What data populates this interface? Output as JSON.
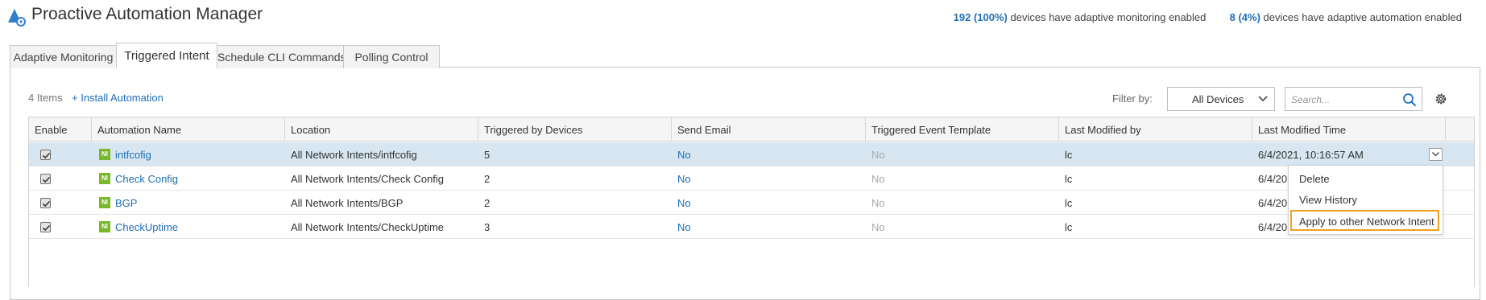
{
  "app": {
    "title": "Proactive Automation Manager",
    "logo_icon": "automation-logo-icon"
  },
  "stats": {
    "monitoring_count": "192 (100%)",
    "monitoring_text": "devices have adaptive monitoring enabled",
    "automation_count": "8 (4%)",
    "automation_text": "devices have adaptive automation enabled"
  },
  "tabs": [
    {
      "label": "Adaptive Monitoring",
      "active": false
    },
    {
      "label": "Triggered Intent",
      "active": true
    },
    {
      "label": "Schedule CLI Commands",
      "active": false
    },
    {
      "label": "Polling Control",
      "active": false
    }
  ],
  "toolbar": {
    "item_count": "4 Items",
    "install_label": "+ Install Automation",
    "filter_label": "Filter by:",
    "filter_value": "All Devices",
    "search_placeholder": "Search...",
    "search_icon": "search-icon",
    "settings_icon": "gear-icon"
  },
  "table": {
    "columns": [
      "Enable",
      "Automation Name",
      "Location",
      "Triggered by Devices",
      "Send Email",
      "Triggered Event Template",
      "Last Modified by",
      "Last Modified Time"
    ],
    "rows": [
      {
        "enabled": true,
        "badge": "NI",
        "name": "intfcofig",
        "location": "All Network Intents/intfcofig",
        "devices": "5",
        "send_email": "No",
        "template": "No",
        "modified_by": "lc",
        "modified_time": "6/4/2021, 10:16:57 AM"
      },
      {
        "enabled": true,
        "badge": "NI",
        "name": "Check Config",
        "location": "All Network Intents/Check Config",
        "devices": "2",
        "send_email": "No",
        "template": "No",
        "modified_by": "lc",
        "modified_time": "6/4/20"
      },
      {
        "enabled": true,
        "badge": "NI",
        "name": "BGP",
        "location": "All Network Intents/BGP",
        "devices": "2",
        "send_email": "No",
        "template": "No",
        "modified_by": "lc",
        "modified_time": "6/4/20"
      },
      {
        "enabled": true,
        "badge": "NI",
        "name": "CheckUptime",
        "location": "All Network Intents/CheckUptime",
        "devices": "3",
        "send_email": "No",
        "template": "No",
        "modified_by": "lc",
        "modified_time": "6/4/20"
      }
    ]
  },
  "context_menu": {
    "items": [
      "Delete",
      "View History",
      "Apply to other Network Intent"
    ],
    "highlighted": "Apply to other Network Intent"
  },
  "colors": {
    "link": "#1f6fb8",
    "badge": "#79b82a",
    "selected_row": "#d7e6f1",
    "highlight_border": "#f0a020"
  }
}
